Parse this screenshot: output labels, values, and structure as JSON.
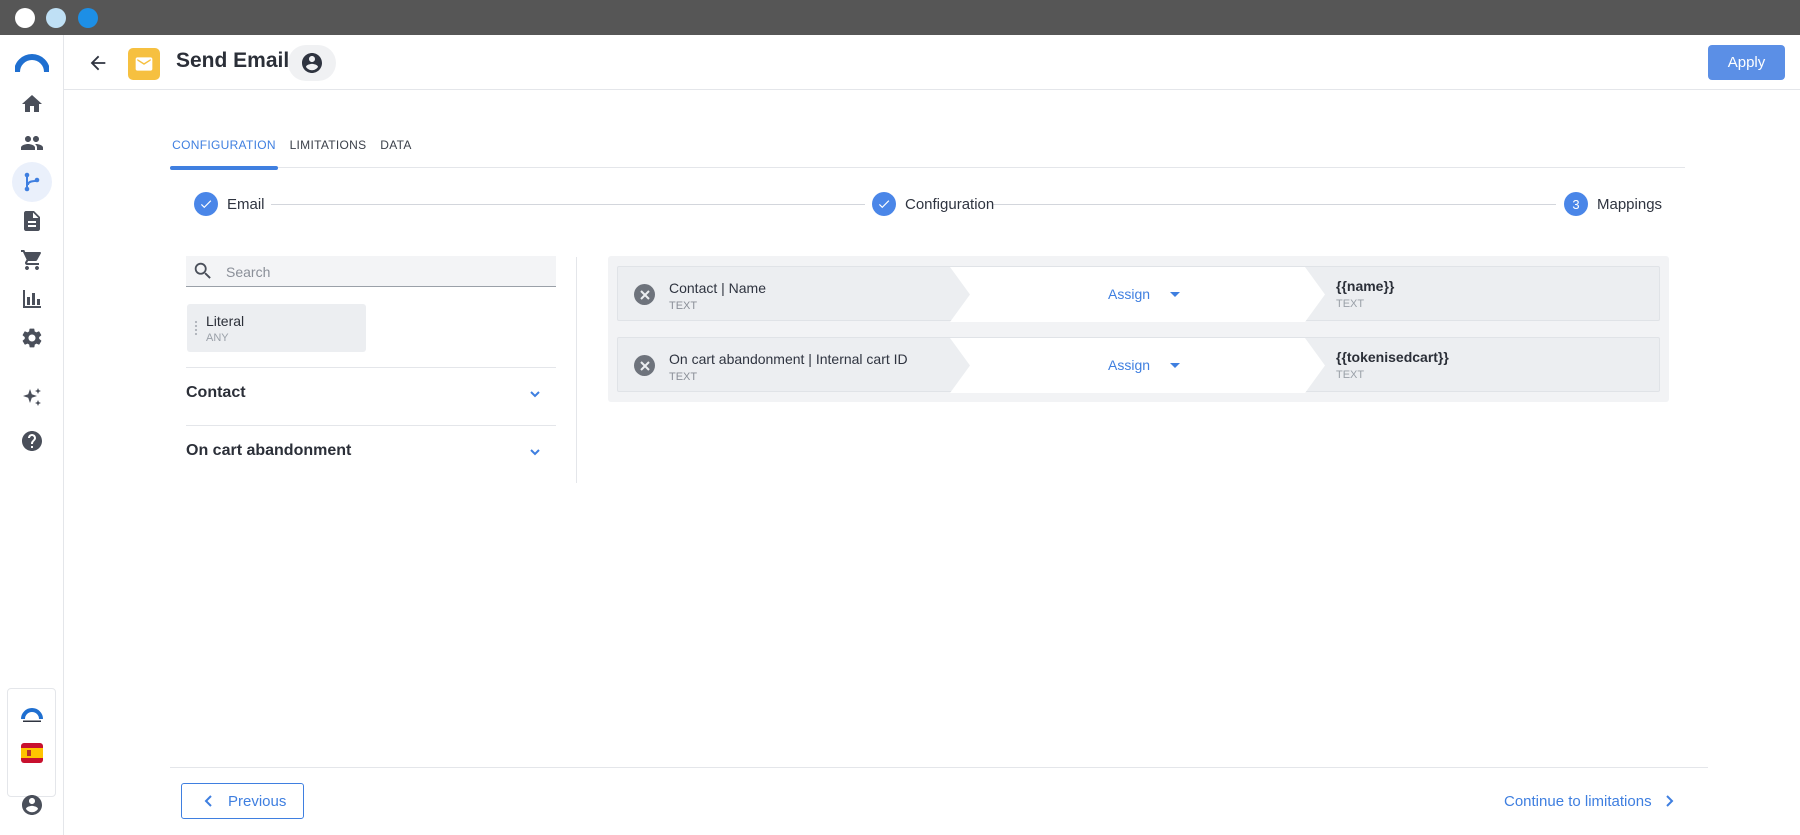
{
  "app": {
    "icons": {
      "logo": "brand-arc-logo",
      "nav": [
        "home-icon",
        "people-icon",
        "flow-branch-icon",
        "document-icon",
        "cart-icon",
        "bar-chart-icon",
        "gear-icon",
        "sparkle-icon",
        "help-icon"
      ],
      "user": "user-circle-icon"
    },
    "colors": {
      "accent": "#3f7fe0",
      "apply": "#5b8fe6",
      "mail_tile": "#f6c040"
    }
  },
  "header": {
    "title": "Send Email",
    "apply_label": "Apply"
  },
  "tabs": [
    {
      "label": "CONFIGURATION",
      "active": true
    },
    {
      "label": "LIMITATIONS",
      "active": false
    },
    {
      "label": "DATA",
      "active": false
    }
  ],
  "stepper": [
    {
      "label": "Email",
      "state": "done"
    },
    {
      "label": "Configuration",
      "state": "done"
    },
    {
      "label": "Mappings",
      "state": "current",
      "number": "3"
    }
  ],
  "left_panel": {
    "search_placeholder": "Search",
    "literal": {
      "title": "Literal",
      "type": "ANY"
    },
    "groups": [
      {
        "title": "Contact"
      },
      {
        "title": "On cart abandonment"
      }
    ]
  },
  "mappings": [
    {
      "source": "Contact | Name",
      "source_type": "TEXT",
      "operator": "Assign",
      "target": "{{name}}",
      "target_type": "TEXT"
    },
    {
      "source": "On cart abandonment | Internal cart ID",
      "source_type": "TEXT",
      "operator": "Assign",
      "target": "{{tokenisedcart}}",
      "target_type": "TEXT"
    }
  ],
  "footer": {
    "previous_label": "Previous",
    "next_label": "Continue to limitations"
  }
}
